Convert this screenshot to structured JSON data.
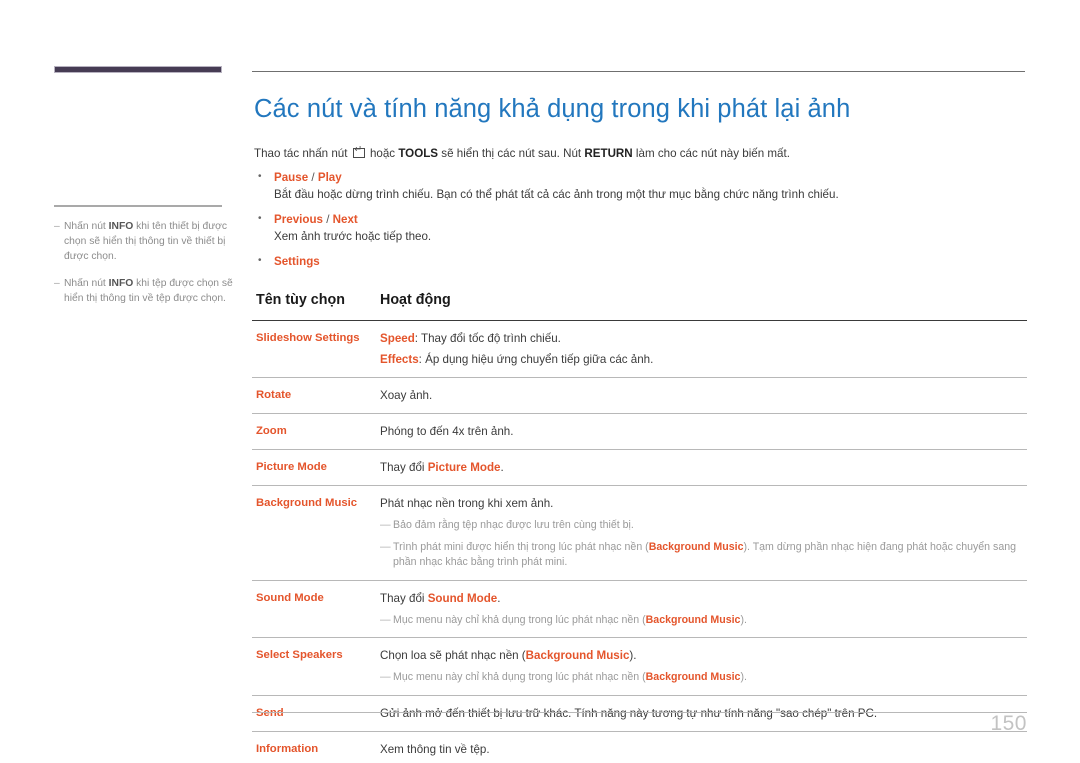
{
  "document": {
    "page_number": "150",
    "title": "Các nút và tính năng khả dụng trong khi phát lại ảnh",
    "intro": {
      "before_icon": "Thao tác nhấn nút",
      "key_icon": "enter-key-icon",
      "after_icon": "hoặc",
      "tools_label": "TOOLS",
      "middle": "sẽ hiển thị các nút sau. Nút",
      "return_label": "RETURN",
      "end": "làm cho các nút này biến mất."
    }
  },
  "colors": {
    "title_blue": "#2277be",
    "accent_orange": "#e4552c",
    "note_gray": "#9a9a9a",
    "header_block": "#463c54"
  },
  "sidebar": {
    "notes": [
      {
        "dash": "–",
        "prefix": "Nhấn nút ",
        "bold": "INFO",
        "suffix": " khi tên thiết bị được chọn sẽ hiển thị thông tin về thiết bị được chọn."
      },
      {
        "dash": "–",
        "prefix": "Nhấn nút ",
        "bold": "INFO",
        "suffix": " khi tệp được chọn sẽ hiển thị thông tin về tệp được chọn."
      }
    ]
  },
  "bullets": [
    {
      "label_a": "Pause",
      "separator": " / ",
      "label_b": "Play",
      "description": "Bắt đầu hoặc dừng trình chiếu. Bạn có thể phát tất cả các ảnh trong một thư mục bằng chức năng trình chiếu."
    },
    {
      "label_a": "Previous",
      "separator": " / ",
      "label_b": "Next",
      "description": "Xem ảnh trước hoặc tiếp theo."
    },
    {
      "label_a": "Settings",
      "separator": "",
      "label_b": "",
      "description": ""
    }
  ],
  "table": {
    "headers": {
      "option_name": "Tên tùy chọn",
      "operation": "Hoạt động"
    },
    "rows": [
      {
        "name": "Slideshow Settings",
        "lines": [
          {
            "hl": "Speed",
            "text": ": Thay đổi tốc độ trình chiếu."
          },
          {
            "hl": "Effects",
            "text": ": Áp dụng hiệu ứng chuyển tiếp giữa các ảnh."
          }
        ],
        "subnotes": []
      },
      {
        "name": "Rotate",
        "lines": [
          {
            "hl": "",
            "text": "Xoay ảnh."
          }
        ],
        "subnotes": []
      },
      {
        "name": "Zoom",
        "lines": [
          {
            "hl": "",
            "text": "Phóng to đến 4x trên ảnh."
          }
        ],
        "subnotes": []
      },
      {
        "name": "Picture Mode",
        "lines": [
          {
            "hl": "",
            "text": "Thay đổi ",
            "hl_after": "Picture Mode",
            "text_after": "."
          }
        ],
        "subnotes": []
      },
      {
        "name": "Background Music",
        "lines": [
          {
            "hl": "",
            "text": "Phát nhạc nền trong khi xem ảnh."
          }
        ],
        "subnotes": [
          {
            "dash": "—",
            "pre": "Bảo đảm rằng tệp nhạc được lưu trên cùng thiết bị.",
            "bold": "",
            "post": ""
          },
          {
            "dash": "—",
            "pre": "Trình phát mini được hiển thị trong lúc phát nhạc nền (",
            "bold": "Background Music",
            "post": "). Tạm dừng phần nhạc hiện đang phát hoặc chuyển sang phần nhạc khác bằng trình phát mini."
          }
        ]
      },
      {
        "name": "Sound Mode",
        "lines": [
          {
            "hl": "",
            "text": "Thay đổi ",
            "hl_after": "Sound Mode",
            "text_after": "."
          }
        ],
        "subnotes": [
          {
            "dash": "—",
            "pre": "Mục menu này chỉ khả dụng trong lúc phát nhạc nền (",
            "bold": "Background Music",
            "post": ")."
          }
        ]
      },
      {
        "name": "Select Speakers",
        "lines": [
          {
            "hl": "",
            "text": "Chọn loa sẽ phát nhạc nền (",
            "hl_after": "Background Music",
            "text_after": ")."
          }
        ],
        "subnotes": [
          {
            "dash": "—",
            "pre": "Mục menu này chỉ khả dụng trong lúc phát nhạc nền (",
            "bold": "Background Music",
            "post": ")."
          }
        ]
      },
      {
        "name": "Send",
        "lines": [
          {
            "hl": "",
            "text": "Gửi ảnh mở đến thiết bị lưu trữ khác. Tính năng này tương tự như tính năng \"sao chép\" trên PC."
          }
        ],
        "subnotes": []
      },
      {
        "name": "Information",
        "lines": [
          {
            "hl": "",
            "text": "Xem thông tin về tệp."
          }
        ],
        "subnotes": []
      }
    ]
  }
}
